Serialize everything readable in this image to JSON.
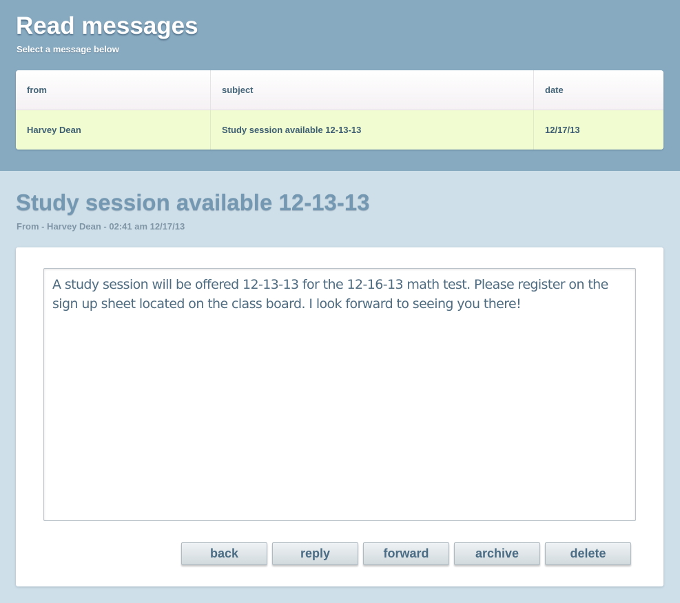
{
  "header": {
    "title": "Read messages",
    "subtitle": "Select a message below"
  },
  "table": {
    "columns": [
      "from",
      "subject",
      "date"
    ],
    "rows": [
      {
        "from": "Harvey Dean",
        "subject": "Study session available 12-13-13",
        "date": "12/17/13"
      }
    ]
  },
  "message": {
    "title": "Study session available 12-13-13",
    "meta": "From - Harvey Dean - 02:41 am 12/17/13",
    "body": "A study session will be offered 12-13-13 for the 12-16-13 math test. Please register on the sign up sheet located on the class board. I look forward to seeing you there!"
  },
  "actions": {
    "back": "back",
    "reply": "reply",
    "forward": "forward",
    "archive": "archive",
    "delete": "delete"
  },
  "colors": {
    "header_band": "#88aac1",
    "page_background": "#cfdfe9",
    "selected_row": "#f1fdd0",
    "heading_text": "#7498b1"
  }
}
